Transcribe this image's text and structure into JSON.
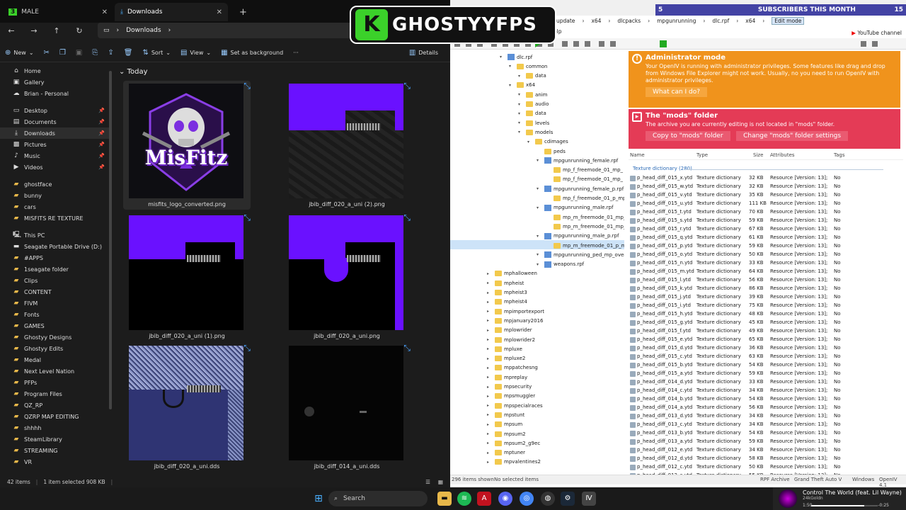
{
  "explorer": {
    "tab1_label": "MALE",
    "tab1_prefix": "3",
    "tab2_label": "Downloads",
    "address": "Downloads",
    "commands": {
      "new": "New",
      "sort": "Sort",
      "view": "View",
      "set_background": "Set as background",
      "more": "···",
      "details": "Details"
    },
    "sidebar": [
      {
        "label": "Home",
        "icon": "home-icon"
      },
      {
        "label": "Gallery",
        "icon": "gallery-icon"
      },
      {
        "label": "Brian - Personal",
        "icon": "cloud-icon"
      },
      {
        "label": "Desktop",
        "icon": "desktop-icon",
        "pinned": true
      },
      {
        "label": "Documents",
        "icon": "documents-icon",
        "pinned": true
      },
      {
        "label": "Downloads",
        "icon": "downloads-icon",
        "pinned": true,
        "selected": true
      },
      {
        "label": "Pictures",
        "icon": "pictures-icon",
        "pinned": true
      },
      {
        "label": "Music",
        "icon": "music-icon",
        "pinned": true
      },
      {
        "label": "Videos",
        "icon": "videos-icon",
        "pinned": true
      },
      {
        "label": "ghostface",
        "icon": "folder-icon"
      },
      {
        "label": "bunny",
        "icon": "folder-icon"
      },
      {
        "label": "cars",
        "icon": "folder-icon"
      },
      {
        "label": "MISFITS RE TEXTURE",
        "icon": "folder-icon"
      },
      {
        "label": "This PC",
        "icon": "pc-icon"
      },
      {
        "label": "Seagate Portable Drive (D:)",
        "icon": "drive-icon"
      },
      {
        "label": "#APPS",
        "icon": "folder-icon"
      },
      {
        "label": "1seagate folder",
        "icon": "folder-icon"
      },
      {
        "label": "Clips",
        "icon": "folder-icon"
      },
      {
        "label": "CONTENT",
        "icon": "folder-icon"
      },
      {
        "label": "FIVM",
        "icon": "folder-icon"
      },
      {
        "label": "Fonts",
        "icon": "folder-icon"
      },
      {
        "label": "GAMES",
        "icon": "folder-icon"
      },
      {
        "label": "Ghostyy Designs",
        "icon": "folder-icon"
      },
      {
        "label": "Ghostyy Edits",
        "icon": "folder-icon"
      },
      {
        "label": "Medal",
        "icon": "folder-icon"
      },
      {
        "label": "Next Level Nation",
        "icon": "folder-icon"
      },
      {
        "label": "PFPs",
        "icon": "folder-icon"
      },
      {
        "label": "Program Files",
        "icon": "folder-icon"
      },
      {
        "label": "QZ_RP",
        "icon": "folder-icon"
      },
      {
        "label": "QZRP MAP EDITING",
        "icon": "folder-icon"
      },
      {
        "label": "shhhh",
        "icon": "folder-icon"
      },
      {
        "label": "SteamLibrary",
        "icon": "folder-icon"
      },
      {
        "label": "STREAMING",
        "icon": "folder-icon"
      },
      {
        "label": "VR",
        "icon": "folder-icon"
      }
    ],
    "group_header": "Today",
    "files": [
      {
        "name": "misfits_logo_converted.png",
        "logo_text": "MisFitz"
      },
      {
        "name": "jbib_diff_020_a_uni (2).png"
      },
      {
        "name": "jbib_diff_020_a_uni (1).png"
      },
      {
        "name": "jbib_diff_020_a_uni.png"
      },
      {
        "name": "jbib_diff_020_a_uni.dds"
      },
      {
        "name": "jbib_diff_014_a_uni.dds"
      }
    ],
    "status": {
      "items": "42 items",
      "selected": "1 item selected  908 KB"
    }
  },
  "overlay": {
    "brand": "GHOSTYYFPS",
    "subs_count": "5",
    "subs_text": "SUBSCRIBERS THIS MONTH",
    "subs_goal": "15"
  },
  "openiv": {
    "path": [
      "update",
      "x64",
      "dlcpacks",
      "mpgunrunning",
      "dlc.rpf",
      "x64"
    ],
    "edit_mode": "Edit mode",
    "menu_help": "elp",
    "youtube": "YouTube channel",
    "tree": [
      {
        "label": "dlc.rpf",
        "level": 0,
        "type": "rpf"
      },
      {
        "label": "common",
        "level": 1,
        "type": "folder"
      },
      {
        "label": "data",
        "level": 2,
        "type": "folder"
      },
      {
        "label": "x64",
        "level": 1,
        "type": "folder"
      },
      {
        "label": "anim",
        "level": 2,
        "type": "folder"
      },
      {
        "label": "audio",
        "level": 2,
        "type": "folder"
      },
      {
        "label": "data",
        "level": 2,
        "type": "folder"
      },
      {
        "label": "levels",
        "level": 2,
        "type": "folder"
      },
      {
        "label": "models",
        "level": 2,
        "type": "folder"
      },
      {
        "label": "cdimages",
        "level": 3,
        "type": "folder"
      },
      {
        "label": "peds",
        "level": 4,
        "type": "folder"
      },
      {
        "label": "mpgunrunning_female.rpf",
        "level": 4,
        "type": "rpf"
      },
      {
        "label": "mp_f_freemode_01_mp_",
        "level": 5,
        "type": "folder"
      },
      {
        "label": "mp_f_freemode_01_mp_",
        "level": 5,
        "type": "folder"
      },
      {
        "label": "mpgunrunning_female_p.rpf",
        "level": 4,
        "type": "rpf"
      },
      {
        "label": "mp_f_freemode_01_p_mp",
        "level": 5,
        "type": "folder"
      },
      {
        "label": "mpgunrunning_male.rpf",
        "level": 4,
        "type": "rpf"
      },
      {
        "label": "mp_m_freemode_01_mp_",
        "level": 5,
        "type": "folder"
      },
      {
        "label": "mp_m_freemode_01_mp_",
        "level": 5,
        "type": "folder"
      },
      {
        "label": "mpgunrunning_male_p.rpf",
        "level": 4,
        "type": "rpf"
      },
      {
        "label": "mp_m_freemode_01_p_m",
        "level": 5,
        "type": "folder",
        "selected": true
      },
      {
        "label": "mpgunrunning_ped_mp_overl",
        "level": 4,
        "type": "rpf"
      },
      {
        "label": "weapons.rpf",
        "level": 4,
        "type": "rpf"
      },
      {
        "label": "mphalloween",
        "level": -1,
        "type": "folder"
      },
      {
        "label": "mpheist",
        "level": -1,
        "type": "folder"
      },
      {
        "label": "mpheist3",
        "level": -1,
        "type": "folder"
      },
      {
        "label": "mpheist4",
        "level": -1,
        "type": "folder"
      },
      {
        "label": "mpimportexport",
        "level": -1,
        "type": "folder"
      },
      {
        "label": "mpjanuary2016",
        "level": -1,
        "type": "folder"
      },
      {
        "label": "mplowrider",
        "level": -1,
        "type": "folder"
      },
      {
        "label": "mplowrider2",
        "level": -1,
        "type": "folder"
      },
      {
        "label": "mpluxe",
        "level": -1,
        "type": "folder"
      },
      {
        "label": "mpluxe2",
        "level": -1,
        "type": "folder"
      },
      {
        "label": "mppatchesng",
        "level": -1,
        "type": "folder"
      },
      {
        "label": "mpreplay",
        "level": -1,
        "type": "folder"
      },
      {
        "label": "mpsecurity",
        "level": -1,
        "type": "folder"
      },
      {
        "label": "mpsmuggler",
        "level": -1,
        "type": "folder"
      },
      {
        "label": "mpspecialraces",
        "level": -1,
        "type": "folder"
      },
      {
        "label": "mpstunt",
        "level": -1,
        "type": "folder"
      },
      {
        "label": "mpsum",
        "level": -1,
        "type": "folder"
      },
      {
        "label": "mpsum2",
        "level": -1,
        "type": "folder"
      },
      {
        "label": "mpsum2_g9ec",
        "level": -1,
        "type": "folder"
      },
      {
        "label": "mptuner",
        "level": -1,
        "type": "folder"
      },
      {
        "label": "mpvalentines2",
        "level": -1,
        "type": "folder"
      }
    ],
    "admin_banner": {
      "title": "Administrator mode",
      "text": "Your OpenIV is running with administrator privileges. Some features like drag and drop from Windows File Explorer might not work. Usually, no you need to run OpenIV with administrator privileges.",
      "button": "What can I do?"
    },
    "mods_banner": {
      "title": "The \"mods\" folder",
      "text": "The archive you are currently editing is not located in \"mods\" folder.",
      "button1": "Copy to \"mods\" folder",
      "button2": "Change \"mods\" folder settings"
    },
    "columns": {
      "name": "Name",
      "type": "Type",
      "size": "Size",
      "attributes": "Attributes",
      "tags": "Tags"
    },
    "group_label": "Texture dictionary (280)",
    "rows": [
      {
        "name": "p_head_diff_015_x.ytd",
        "size": "32 KB"
      },
      {
        "name": "p_head_diff_015_w.ytd",
        "size": "32 KB"
      },
      {
        "name": "p_head_diff_015_v.ytd",
        "size": "35 KB"
      },
      {
        "name": "p_head_diff_015_u.ytd",
        "size": "111 KB"
      },
      {
        "name": "p_head_diff_015_t.ytd",
        "size": "70 KB"
      },
      {
        "name": "p_head_diff_015_s.ytd",
        "size": "59 KB"
      },
      {
        "name": "p_head_diff_015_r.ytd",
        "size": "67 KB"
      },
      {
        "name": "p_head_diff_015_q.ytd",
        "size": "61 KB"
      },
      {
        "name": "p_head_diff_015_p.ytd",
        "size": "59 KB"
      },
      {
        "name": "p_head_diff_015_o.ytd",
        "size": "50 KB"
      },
      {
        "name": "p_head_diff_015_n.ytd",
        "size": "33 KB"
      },
      {
        "name": "p_head_diff_015_m.ytd",
        "size": "64 KB"
      },
      {
        "name": "p_head_diff_015_l.ytd",
        "size": "56 KB"
      },
      {
        "name": "p_head_diff_015_k.ytd",
        "size": "86 KB"
      },
      {
        "name": "p_head_diff_015_j.ytd",
        "size": "39 KB"
      },
      {
        "name": "p_head_diff_015_i.ytd",
        "size": "75 KB"
      },
      {
        "name": "p_head_diff_015_h.ytd",
        "size": "48 KB"
      },
      {
        "name": "p_head_diff_015_g.ytd",
        "size": "45 KB"
      },
      {
        "name": "p_head_diff_015_f.ytd",
        "size": "49 KB"
      },
      {
        "name": "p_head_diff_015_e.ytd",
        "size": "65 KB"
      },
      {
        "name": "p_head_diff_015_d.ytd",
        "size": "36 KB"
      },
      {
        "name": "p_head_diff_015_c.ytd",
        "size": "63 KB"
      },
      {
        "name": "p_head_diff_015_b.ytd",
        "size": "54 KB"
      },
      {
        "name": "p_head_diff_015_a.ytd",
        "size": "59 KB"
      },
      {
        "name": "p_head_diff_014_d.ytd",
        "size": "33 KB"
      },
      {
        "name": "p_head_diff_014_c.ytd",
        "size": "34 KB"
      },
      {
        "name": "p_head_diff_014_b.ytd",
        "size": "54 KB"
      },
      {
        "name": "p_head_diff_014_a.ytd",
        "size": "56 KB"
      },
      {
        "name": "p_head_diff_013_d.ytd",
        "size": "34 KB"
      },
      {
        "name": "p_head_diff_013_c.ytd",
        "size": "34 KB"
      },
      {
        "name": "p_head_diff_013_b.ytd",
        "size": "54 KB"
      },
      {
        "name": "p_head_diff_013_a.ytd",
        "size": "59 KB"
      },
      {
        "name": "p_head_diff_012_e.ytd",
        "size": "34 KB"
      },
      {
        "name": "p_head_diff_012_d.ytd",
        "size": "58 KB"
      },
      {
        "name": "p_head_diff_012_c.ytd",
        "size": "50 KB"
      },
      {
        "name": "p_head_diff_012_c.ytd",
        "size": "55 KB"
      }
    ],
    "row_type": "Texture dictionary",
    "row_attr": "Resource [Version: 13];",
    "row_tag": "No",
    "status": {
      "items": "296 items shown",
      "selected": "No selected items",
      "archive": "RPF Archive",
      "game": "Grand Theft Auto V",
      "os": "Windows",
      "version": "OpenIV 4.1"
    }
  },
  "taskbar": {
    "search": "Search",
    "song_title": "Control The World (feat. Lil Wayne)",
    "song_artist": "24kGoldn",
    "elapsed": "1:50",
    "remaining": "-0:25",
    "progress": 0.8
  }
}
